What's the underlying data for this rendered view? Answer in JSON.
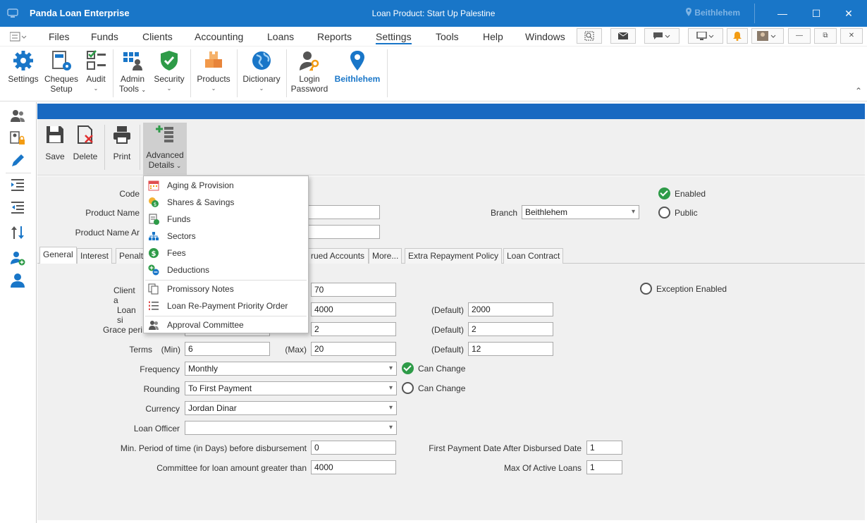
{
  "window": {
    "app_title": "Panda Loan Enterprise",
    "doc_title": "Loan Product: Start Up Palestine",
    "location": "Beithlehem",
    "minimize": "—",
    "maximize": "☐",
    "close": "✕"
  },
  "menubar": {
    "items": [
      "Files",
      "Funds",
      "Clients",
      "Accounting",
      "Loans",
      "Reports",
      "Settings",
      "Tools",
      "Help",
      "Windows"
    ],
    "active": "Settings"
  },
  "ribbon": {
    "settings": "Settings",
    "cheques_setup_1": "Cheques",
    "cheques_setup_2": "Setup",
    "audit": "Audit",
    "admin_tools_1": "Admin",
    "admin_tools_2": "Tools",
    "security": "Security",
    "products": "Products",
    "dictionary": "Dictionary",
    "login_password_1": "Login",
    "login_password_2": "Password",
    "branch": "Beithlehem"
  },
  "toolbar": {
    "save": "Save",
    "delete": "Delete",
    "print": "Print",
    "advanced_1": "Advanced",
    "advanced_2": "Details"
  },
  "advanced_menu": {
    "items": [
      "Aging & Provision",
      "Shares & Savings",
      "Funds",
      "Sectors",
      "Fees",
      "Deductions",
      "Promissory Notes",
      "Loan Re-Payment Priority Order",
      "Approval Committee"
    ]
  },
  "header": {
    "code_label": "Code",
    "product_name_label": "Product Name",
    "product_name_ar_label": "Product Name Ar",
    "branch_label": "Branch",
    "branch_value": "Beithlehem",
    "enabled_label": "Enabled",
    "public_label": "Public"
  },
  "tabs": [
    "General",
    "Interest",
    "Penalt",
    "rued Accounts",
    "More...",
    "Extra Repayment Policy",
    "Loan Contract"
  ],
  "general": {
    "client_age_label": "Client a",
    "client_age_max": "70",
    "exception_enabled": "Exception Enabled",
    "loan_size_label": "Loan si",
    "loan_size_max": "4000",
    "loan_size_default": "2000",
    "grace_label": "Grace peri",
    "grace_max": "2",
    "grace_default": "2",
    "terms_label": "Terms",
    "min_label": "(Min)",
    "max_label": "(Max)",
    "default_label": "(Default)",
    "terms_min": "6",
    "terms_max": "20",
    "terms_default": "12",
    "frequency_label": "Frequency",
    "frequency_value": "Monthly",
    "can_change": "Can Change",
    "rounding_label": "Rounding",
    "rounding_value": "To First Payment",
    "currency_label": "Currency",
    "currency_value": "Jordan Dinar",
    "loan_officer_label": "Loan Officer",
    "loan_officer_value": "",
    "min_period_label": "Min. Period of time (in Days) before disbursement",
    "min_period_value": "0",
    "committee_label": "Committee for loan amount greater than",
    "committee_value": "4000",
    "first_payment_label": "First Payment Date After Disbursed Date",
    "first_payment_value": "1",
    "max_active_label": "Max Of Active Loans",
    "max_active_value": "1"
  }
}
